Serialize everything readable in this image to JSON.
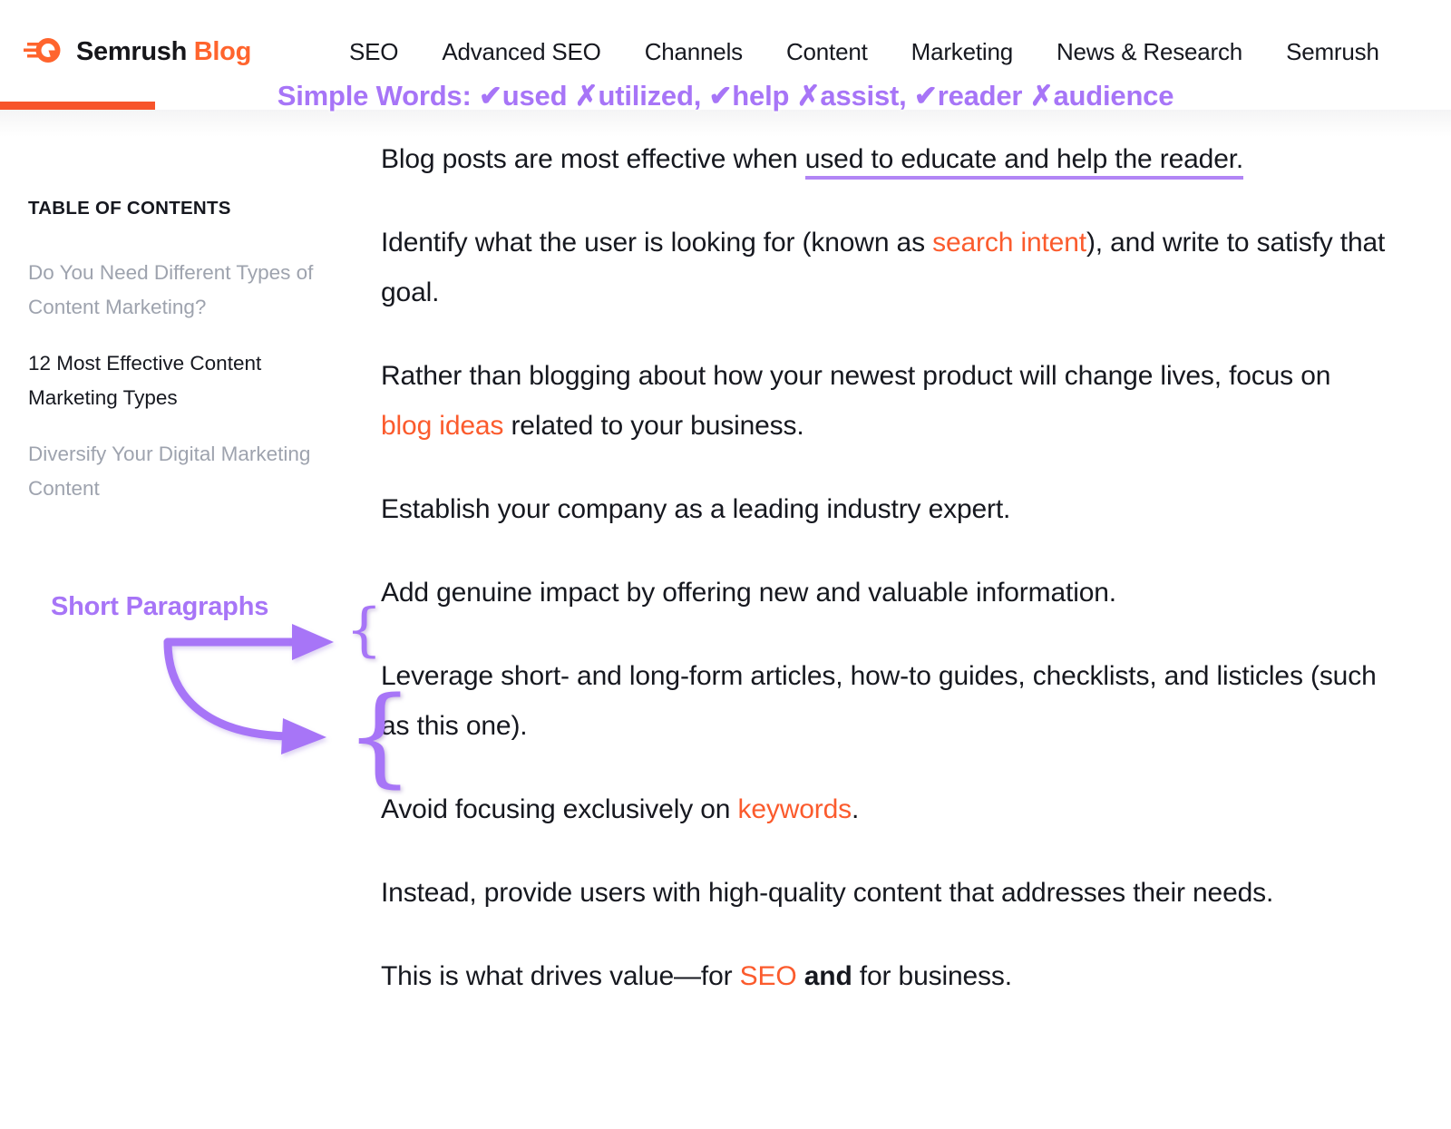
{
  "header": {
    "logo_icon": "semrush-comet-logo",
    "brand_name": "Semrush",
    "brand_suffix": "Blog",
    "nav_items": [
      {
        "label": "SEO"
      },
      {
        "label": "Advanced SEO"
      },
      {
        "label": "Channels"
      },
      {
        "label": "Content"
      },
      {
        "label": "Marketing"
      },
      {
        "label": "News & Research"
      },
      {
        "label": "Semrush"
      }
    ],
    "progress_percent": 11
  },
  "annotations": {
    "top_banner": "Simple Words: ✔used ✗utilized, ✔help ✗assist, ✔reader ✗audience",
    "left_label": "Short Paragraphs",
    "color_purple": "#a775f7",
    "underline_color": "#b185f5",
    "brace_glyph": "{"
  },
  "sidebar": {
    "title": "TABLE OF CONTENTS",
    "items": [
      {
        "label": "Do You Need Different Types of Content Marketing?",
        "active": false
      },
      {
        "label": "12 Most Effective Content Marketing Types",
        "active": true
      },
      {
        "label": "Diversify Your Digital Marketing Content",
        "active": false
      }
    ]
  },
  "article": {
    "paragraphs": [
      {
        "id": "p1",
        "segments": [
          {
            "text": "Blog posts are most effective when ",
            "style": "plain"
          },
          {
            "text": "used to educate and help the reader.",
            "style": "annotated-underline"
          }
        ]
      },
      {
        "id": "p2",
        "segments": [
          {
            "text": "Identify what the user is looking for (known as ",
            "style": "plain"
          },
          {
            "text": "search intent",
            "style": "link"
          },
          {
            "text": "), and write to satisfy that goal.",
            "style": "plain"
          }
        ]
      },
      {
        "id": "p3",
        "segments": [
          {
            "text": "Rather than blogging about how your newest product will change lives, focus on ",
            "style": "plain"
          },
          {
            "text": "blog ideas",
            "style": "link"
          },
          {
            "text": " related to your business.",
            "style": "plain"
          }
        ]
      },
      {
        "id": "p4",
        "segments": [
          {
            "text": "Establish your company as a leading industry expert.",
            "style": "plain"
          }
        ]
      },
      {
        "id": "p5",
        "segments": [
          {
            "text": "Add genuine impact by offering new and valuable information.",
            "style": "plain"
          }
        ]
      },
      {
        "id": "p6",
        "segments": [
          {
            "text": "Leverage short- and long-form articles, how-to guides, checklists, and listicles (such as this one).",
            "style": "plain"
          }
        ]
      },
      {
        "id": "p7",
        "segments": [
          {
            "text": "Avoid focusing exclusively on ",
            "style": "plain"
          },
          {
            "text": "keywords",
            "style": "link"
          },
          {
            "text": ".",
            "style": "plain"
          }
        ]
      },
      {
        "id": "p8",
        "segments": [
          {
            "text": "Instead, provide users with high-quality content that addresses their needs.",
            "style": "plain"
          }
        ]
      },
      {
        "id": "p9",
        "segments": [
          {
            "text": "This is what drives value—for ",
            "style": "plain"
          },
          {
            "text": "SEO",
            "style": "link"
          },
          {
            "text": " ",
            "style": "plain"
          },
          {
            "text": "and",
            "style": "bold"
          },
          {
            "text": " for business.",
            "style": "plain"
          }
        ]
      }
    ]
  },
  "colors": {
    "brand_orange": "#ff642d",
    "link_orange": "#fb5b2d",
    "progress_orange": "#f7542b",
    "annotation_purple": "#a775f7",
    "text_dark": "#16181f",
    "text_muted": "#9ea3ae"
  }
}
